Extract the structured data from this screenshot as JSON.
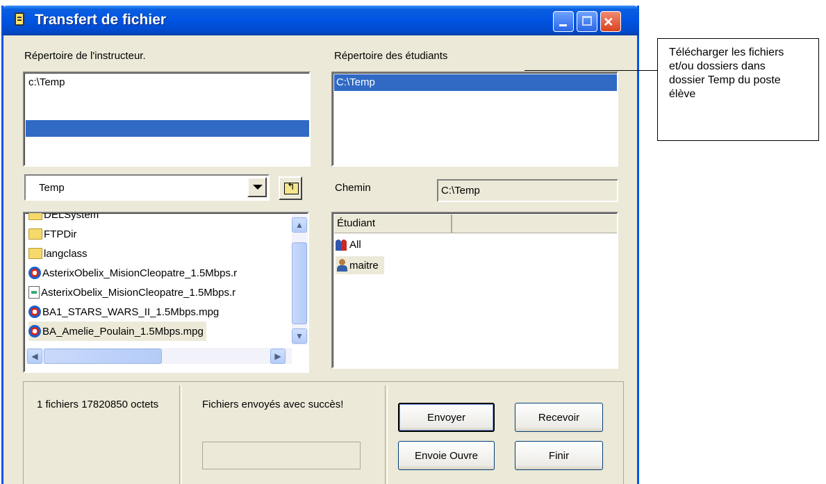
{
  "window": {
    "title": "Transfert de fichier",
    "controls": {
      "minimize": "minimize-icon",
      "maximize": "maximize-icon",
      "close": "×"
    }
  },
  "instructor": {
    "label": "Répertoire de l'instructeur.",
    "directory_items": [
      "c:\\Temp"
    ],
    "combo_value": "Temp",
    "files": [
      {
        "name": "DELSystem",
        "icon": "folder-icon"
      },
      {
        "name": "FTPDir",
        "icon": "folder-icon"
      },
      {
        "name": "langclass",
        "icon": "folder-icon"
      },
      {
        "name": "AsterixObelix_MisionCleopatre_1.5Mbps.r",
        "icon": "media-file-icon"
      },
      {
        "name": "AsterixObelix_MisionCleopatre_1.5Mbps.r",
        "icon": "document-file-icon"
      },
      {
        "name": "BA1_STARS_WARS_II_1.5Mbps.mpg",
        "icon": "media-file-icon"
      },
      {
        "name": "BA_Amelie_Poulain_1.5Mbps.mpg",
        "icon": "media-file-icon"
      }
    ]
  },
  "students": {
    "label": "Répertoire des étudiants",
    "directory_items": [
      "C:\\Temp"
    ],
    "path_label": "Chemin",
    "path_value": "C:\\Temp",
    "column_header": "Étudiant",
    "rows": [
      {
        "name": "All",
        "icon": "group-icon"
      },
      {
        "name": "maitre",
        "icon": "user-icon"
      }
    ]
  },
  "status": {
    "file_count": "1 fichiers 17820850 octets",
    "message": "Fichiers envoyés avec succès!"
  },
  "buttons": {
    "send": "Envoyer",
    "receive": "Recevoir",
    "send_open": "Envoie Ouvre",
    "finish": "Finir"
  },
  "annotation": "Télécharger les fichiers et/ou dossiers dans dossier Temp du poste élève"
}
